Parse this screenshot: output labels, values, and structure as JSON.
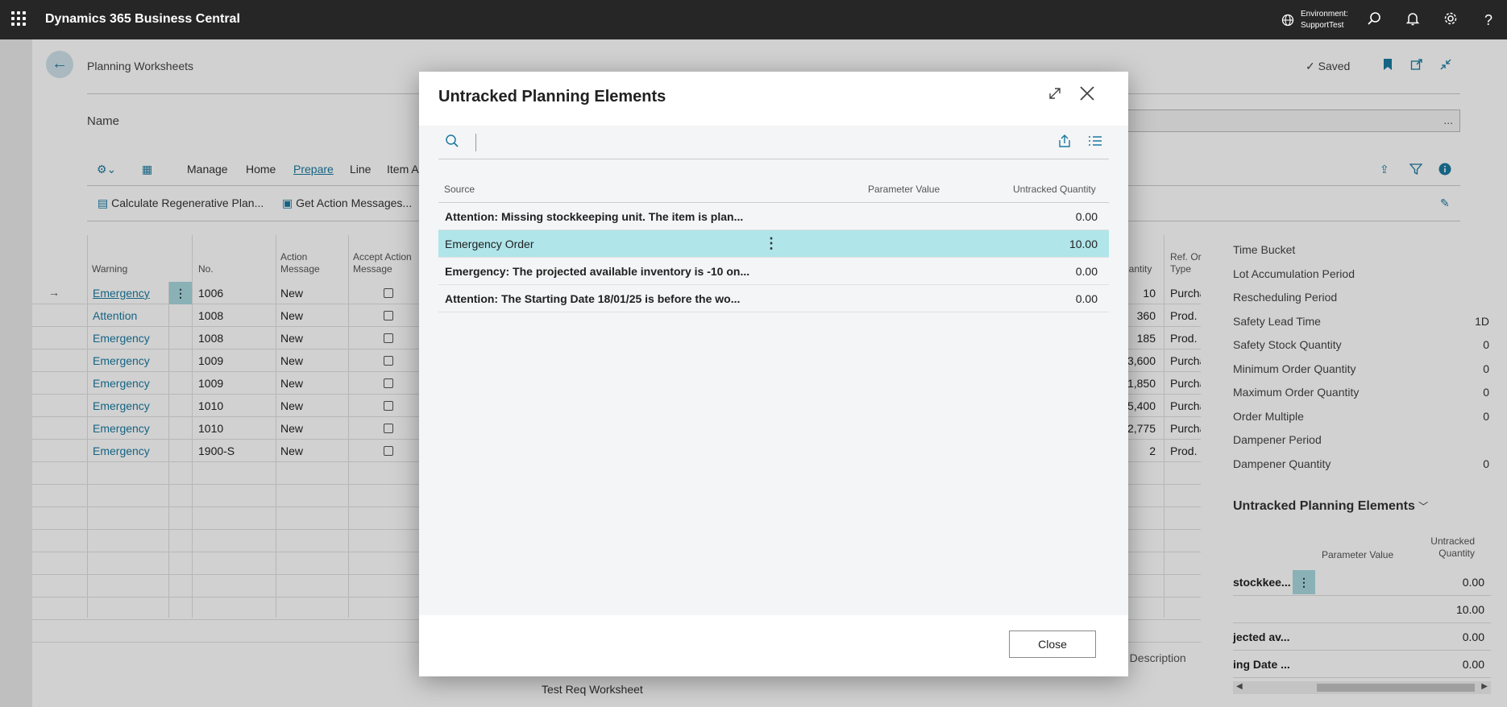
{
  "topbar": {
    "app_title": "Dynamics 365 Business Central",
    "environment_label": "Environment:",
    "environment_name": "SupportTest"
  },
  "page": {
    "breadcrumb": "Planning Worksheets",
    "saved_label": "Saved",
    "name_label": "Name",
    "name_value": "...",
    "menu": [
      "Manage",
      "Home",
      "Prepare",
      "Line",
      "Item A"
    ],
    "actions": {
      "calc_plan": "Calculate Regenerative Plan...",
      "get_action": "Get Action Messages..."
    },
    "columns": {
      "warning": "Warning",
      "no": "No.",
      "action_message": "Action Message",
      "accept_action": "Accept Action Message",
      "quantity": "uantity",
      "ref_order_type": "Ref. Or Type"
    },
    "rows": [
      {
        "warning": "Emergency",
        "no": "1006",
        "action": "New",
        "qty": "10",
        "ref": "Purcha"
      },
      {
        "warning": "Attention",
        "no": "1008",
        "action": "New",
        "qty": "360",
        "ref": "Prod. C"
      },
      {
        "warning": "Emergency",
        "no": "1008",
        "action": "New",
        "qty": "185",
        "ref": "Prod. C"
      },
      {
        "warning": "Emergency",
        "no": "1009",
        "action": "New",
        "qty": "3,600",
        "ref": "Purcha"
      },
      {
        "warning": "Emergency",
        "no": "1009",
        "action": "New",
        "qty": "1,850",
        "ref": "Purcha"
      },
      {
        "warning": "Emergency",
        "no": "1010",
        "action": "New",
        "qty": "5,400",
        "ref": "Purcha"
      },
      {
        "warning": "Emergency",
        "no": "1010",
        "action": "New",
        "qty": "2,775",
        "ref": "Purcha"
      },
      {
        "warning": "Emergency",
        "no": "1900-S",
        "action": "New",
        "qty": "2",
        "ref": "Prod. C"
      }
    ],
    "footer": {
      "desc_label": "g Description",
      "worksheet_name": "Test Req Worksheet"
    }
  },
  "factbox": {
    "items": [
      {
        "label": "Time Bucket",
        "value": ""
      },
      {
        "label": "Lot Accumulation Period",
        "value": ""
      },
      {
        "label": "Rescheduling Period",
        "value": ""
      },
      {
        "label": "Safety Lead Time",
        "value": "1D"
      },
      {
        "label": "Safety Stock Quantity",
        "value": "0"
      },
      {
        "label": "Minimum Order Quantity",
        "value": "0"
      },
      {
        "label": "Maximum Order Quantity",
        "value": "0"
      },
      {
        "label": "Order Multiple",
        "value": "0"
      },
      {
        "label": "Dampener Period",
        "value": ""
      },
      {
        "label": "Dampener Quantity",
        "value": "0"
      }
    ],
    "part_title": "Untracked Planning Elements",
    "part_columns": {
      "param": "Parameter Value",
      "qty": "Untracked Quantity"
    },
    "part_rows": [
      {
        "src": "stockkee...",
        "qty": "0.00"
      },
      {
        "src": "",
        "qty": "10.00"
      },
      {
        "src": "jected av...",
        "qty": "0.00"
      },
      {
        "src": "ing Date ...",
        "qty": "0.00"
      }
    ]
  },
  "dialog": {
    "title": "Untracked Planning Elements",
    "columns": {
      "source": "Source",
      "parameter_value": "Parameter Value",
      "untracked_quantity": "Untracked Quantity"
    },
    "rows": [
      {
        "source": "Attention: Missing stockkeeping unit. The item is plan...",
        "param": "",
        "qty": "0.00",
        "bold": true
      },
      {
        "source": "Emergency Order",
        "param": "",
        "qty": "10.00",
        "bold": false,
        "selected": true
      },
      {
        "source": "Emergency: The projected available inventory is -10 on...",
        "param": "",
        "qty": "0.00",
        "bold": true
      },
      {
        "source": "Attention: The Starting Date 18/01/25 is before the wo...",
        "param": "",
        "qty": "0.00",
        "bold": true
      }
    ],
    "close_label": "Close"
  },
  "colors": {
    "accent": "#1a7aa0",
    "selected_row": "#b0e5ea",
    "topbar": "#262626"
  }
}
